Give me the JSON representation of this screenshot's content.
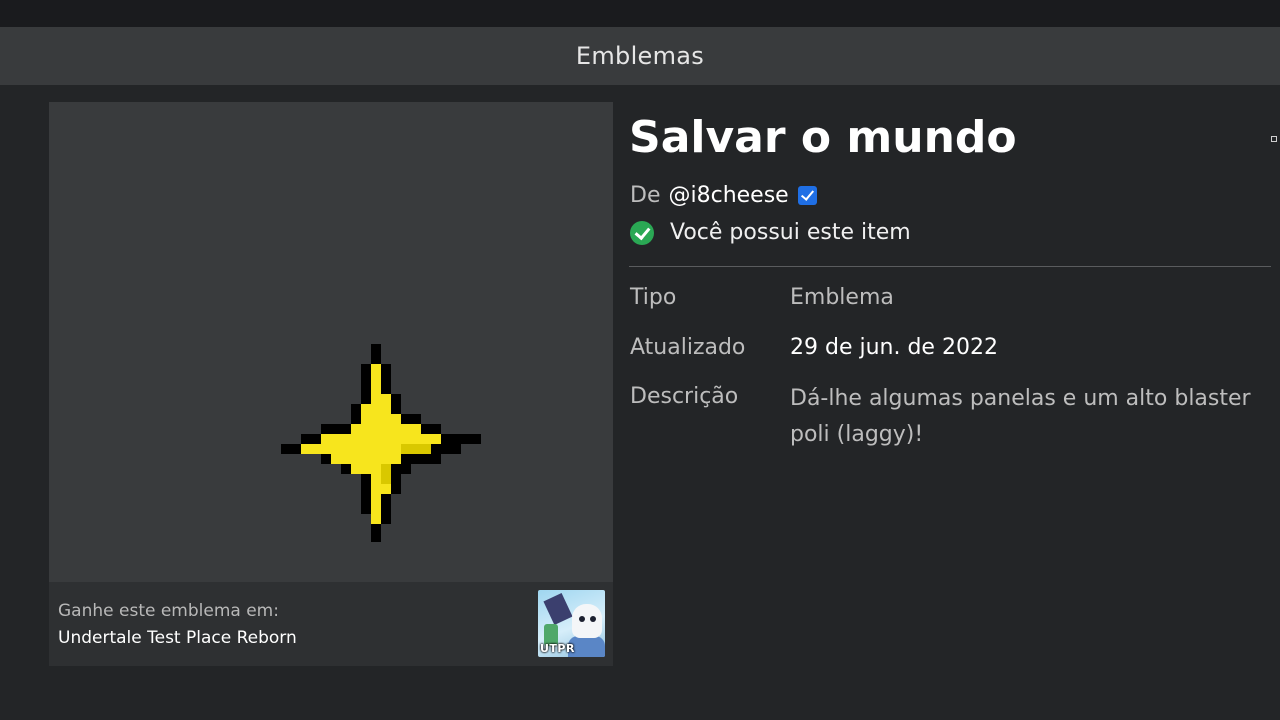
{
  "header": {
    "title": "Emblemas"
  },
  "badge": {
    "image_icon": "pixel-star-icon",
    "earn_label": "Ganhe este emblema em:",
    "earn_game": "Undertale Test Place Reborn",
    "game_thumbnail_text": "UTPR"
  },
  "item": {
    "title": "Salvar o mundo",
    "by_label": "De",
    "creator": "@i8cheese",
    "owned_text": "Você possui este item",
    "details": {
      "type_label": "Tipo",
      "type_value": "Emblema",
      "updated_label": "Atualizado",
      "updated_value": "29 de jun. de 2022",
      "description_label": "Descrição",
      "description_value_line1": "Dá-lhe algumas panelas e um alto blaster",
      "description_value_line2": "poli (laggy)!"
    }
  },
  "colors": {
    "background": "#232527",
    "panel": "#393b3d",
    "verified": "#1f6fe5",
    "owned_check": "#2aa854",
    "star_fill": "#f7e51d"
  }
}
